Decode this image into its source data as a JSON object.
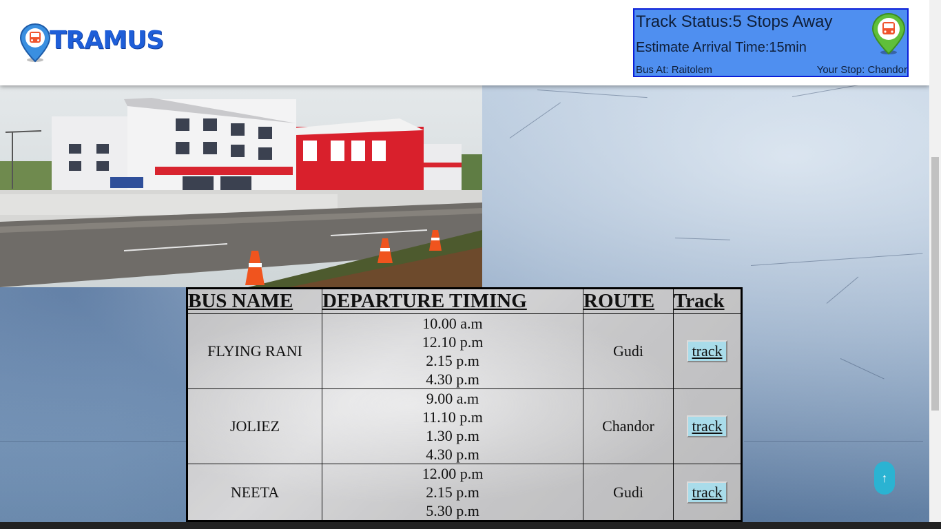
{
  "brand": {
    "name": "TRAMUS"
  },
  "status_panel": {
    "track_status": "Track Status:5 Stops Away",
    "arrival": "Estimate Arrival Time:15min",
    "bus_at": "Bus At: Raitolem",
    "your_stop": "Your Stop: Chandor"
  },
  "table": {
    "headers": [
      "BUS NAME",
      "DEPARTURE TIMING",
      "ROUTE",
      "Track"
    ],
    "rows": [
      {
        "bus": "FLYING RANI",
        "timings": [
          "10.00 a.m",
          "12.10 p.m",
          "2.15 p.m",
          "4.30 p.m"
        ],
        "route": "Gudi",
        "track": "track"
      },
      {
        "bus": "JOLIEZ",
        "timings": [
          "9.00 a.m",
          "11.10 p.m",
          "1.30 p.m",
          "4.30 p.m"
        ],
        "route": "Chandor",
        "track": "track"
      },
      {
        "bus": "NEETA",
        "timings": [
          "12.00 p.m",
          "2.15 p.m",
          "5.30 p.m"
        ],
        "route": "Gudi",
        "track": "track"
      }
    ]
  },
  "back_to_top": {
    "icon": "arrow-up-icon",
    "glyph": "↑"
  },
  "colors": {
    "brand_blue": "#1e5ed8",
    "status_bg": "#4f8ff0",
    "status_border": "#0a1ed8",
    "track_btn": "#a9dcea",
    "back_to_top": "#2bb3d2"
  }
}
